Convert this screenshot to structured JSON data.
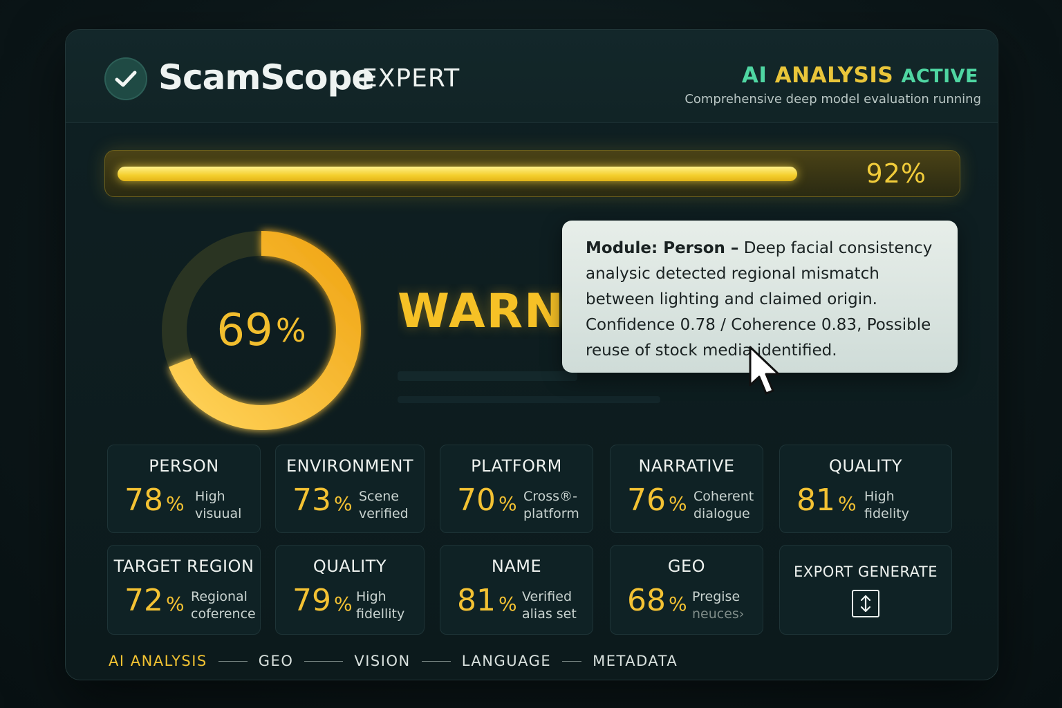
{
  "header": {
    "brand": "ScamScope",
    "brand_sub": "EXPERT",
    "status_ai": "AI",
    "status_analysis": "ANALYSIS",
    "status_active": "ACTIVE",
    "status_sub": "Comprehensive deep model evaluation running"
  },
  "progress": {
    "value": 92,
    "label": "92",
    "unit": "%"
  },
  "overall": {
    "value": 69,
    "label": "69",
    "unit": "%",
    "status": "WARNING"
  },
  "tooltip": {
    "heading": "Module: Person –",
    "body": " Deep facial consistency analysic detected regional mismatch between lighting and claimed origin. Confidence 0.78 / Coherence 0.83, Possible reuse of stock media identified."
  },
  "cards": [
    {
      "title": "PERSON",
      "value": "78",
      "unit": "%",
      "desc1": "High",
      "desc2": "visuual"
    },
    {
      "title": "ENVIRONMENT",
      "value": "73",
      "unit": "%",
      "desc1": "Scene",
      "desc2": "verified"
    },
    {
      "title": "PLATFORM",
      "value": "70",
      "unit": "%",
      "desc1": "Cross®-",
      "desc2": "platform"
    },
    {
      "title": "NARRATIVE",
      "value": "76",
      "unit": "%",
      "desc1": "Coherent",
      "desc2": "dialogue"
    },
    {
      "title": "QUALITY",
      "value": "81",
      "unit": "%",
      "desc1": "High",
      "desc2": "fidelity"
    },
    {
      "title": "TARGET REGION",
      "value": "72",
      "unit": "%",
      "desc1": "Regional",
      "desc2": "coference"
    },
    {
      "title": "QUALITY",
      "value": "79",
      "unit": "%",
      "desc1": "High",
      "desc2": "fidellity"
    },
    {
      "title": "NAME",
      "value": "81",
      "unit": "%",
      "desc1": "Verified",
      "desc2": "alias set"
    },
    {
      "title": "GEO",
      "value": "68",
      "unit": "%",
      "desc1": "Pregise",
      "desc2": "neuces›"
    }
  ],
  "export": {
    "title": "EXPORT GENERATE",
    "icon": "resize-vertical-icon"
  },
  "nav": [
    "AI ANALYSIS",
    "GEO",
    "VISION",
    "LANGUAGE",
    "METADATA"
  ],
  "colors": {
    "accent": "#f4c233",
    "status_green": "#4fd6a2",
    "panel": "#0f2023",
    "tooltip": "#e2eae6"
  }
}
